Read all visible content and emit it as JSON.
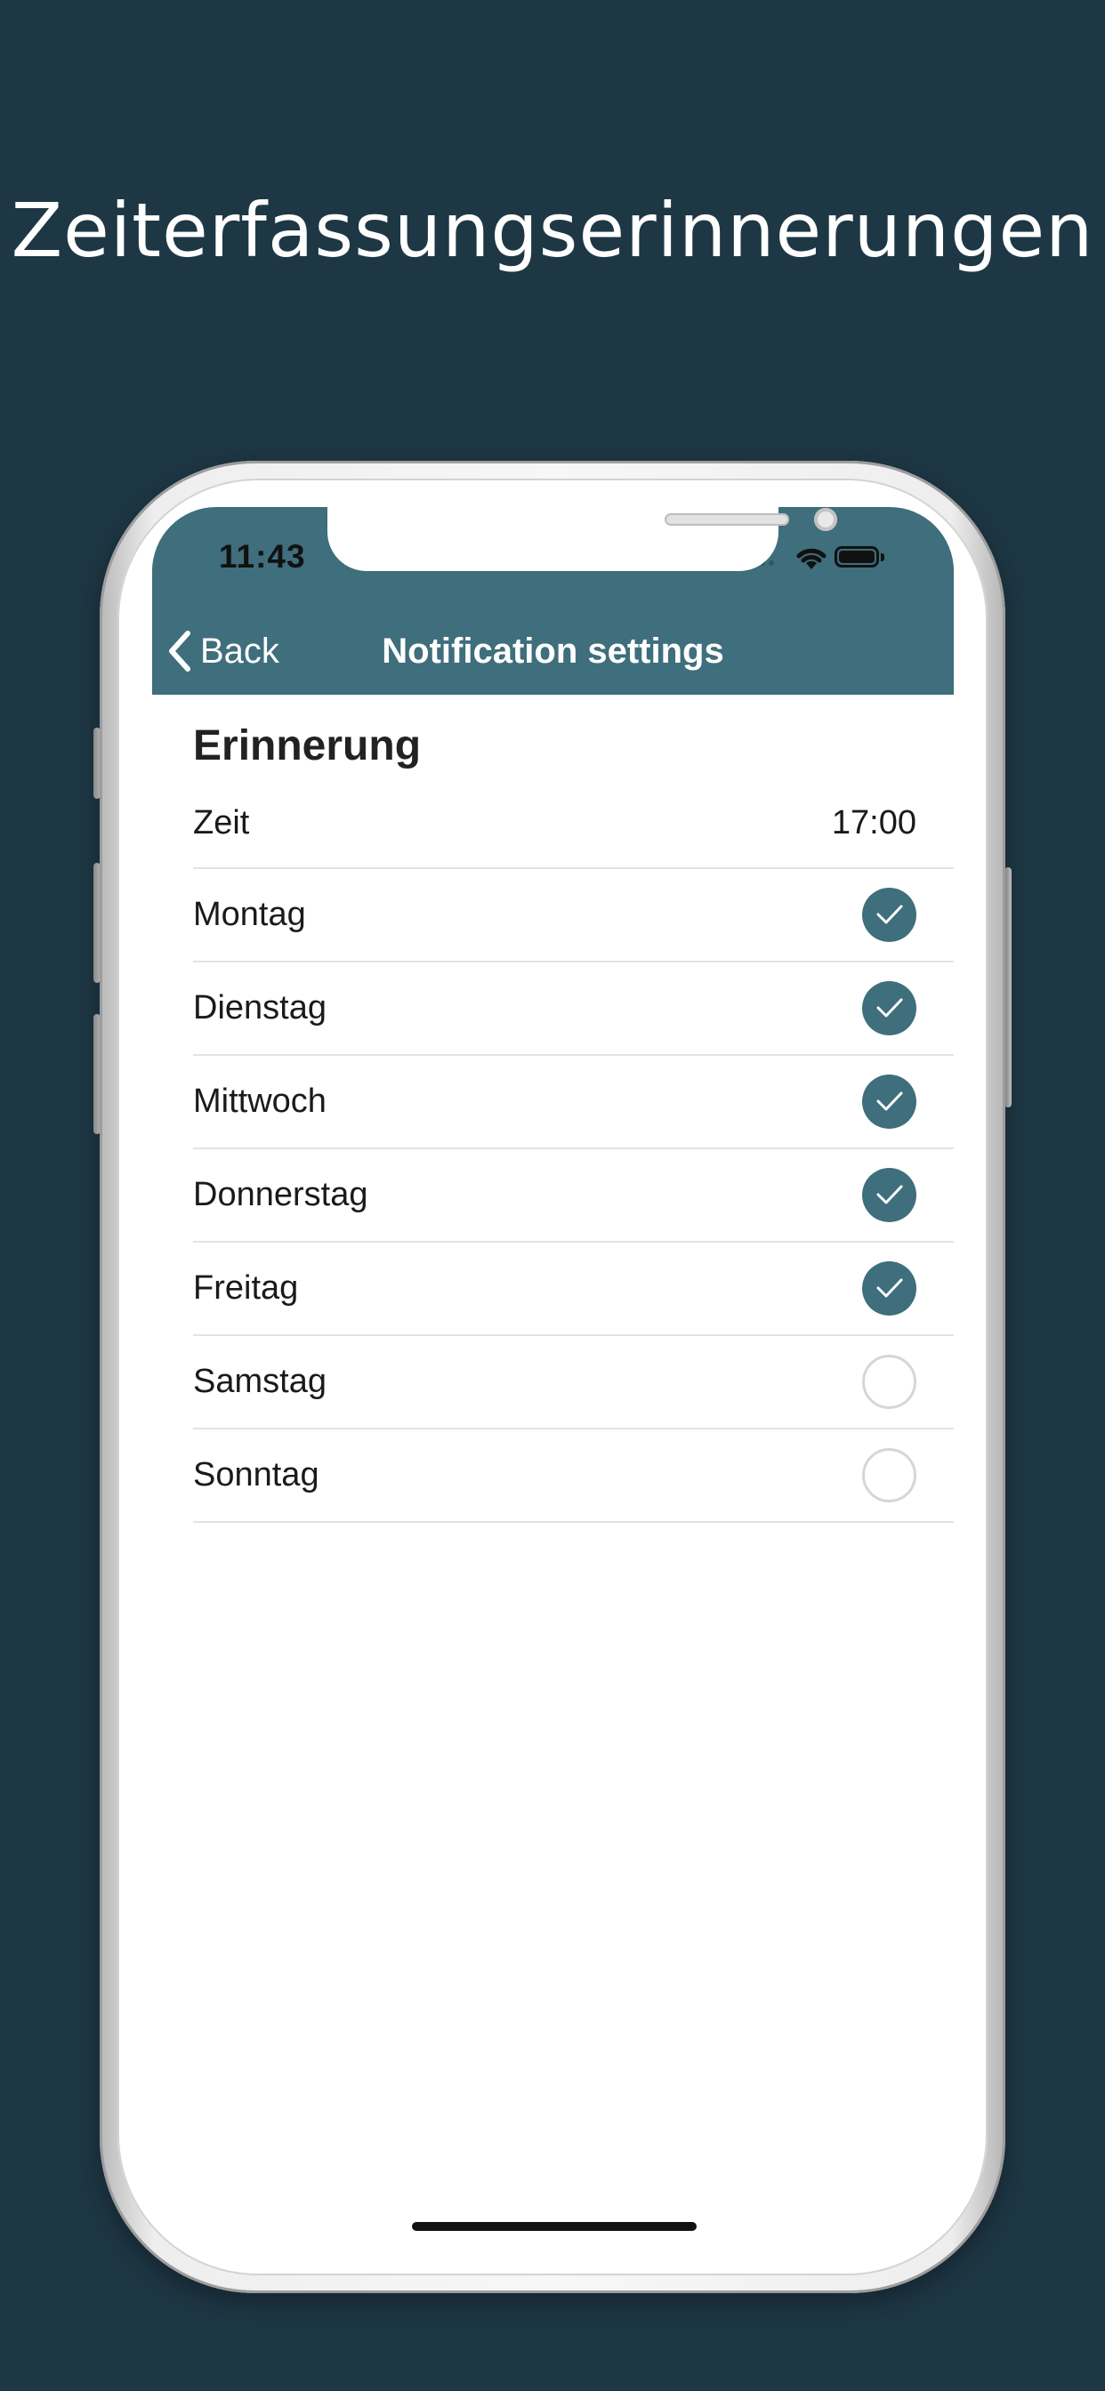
{
  "headline": "Zeiterfassungserinnerungen",
  "status_bar": {
    "time": "11:43"
  },
  "nav": {
    "back_label": "Back",
    "title": "Notification settings"
  },
  "section": {
    "title": "Erinnerung",
    "time_label": "Zeit",
    "time_value": "17:00"
  },
  "days": [
    {
      "label": "Montag",
      "checked": true
    },
    {
      "label": "Dienstag",
      "checked": true
    },
    {
      "label": "Mittwoch",
      "checked": true
    },
    {
      "label": "Donnerstag",
      "checked": true
    },
    {
      "label": "Freitag",
      "checked": true
    },
    {
      "label": "Samstag",
      "checked": false
    },
    {
      "label": "Sonntag",
      "checked": false
    }
  ],
  "colors": {
    "background": "#1e3745",
    "accent": "#3f6e7c",
    "unchecked_border": "#d6d6d6"
  },
  "icons": {
    "back": "chevron-left-icon",
    "checked": "checkmark-icon",
    "wifi": "wifi-icon",
    "battery": "battery-icon"
  }
}
